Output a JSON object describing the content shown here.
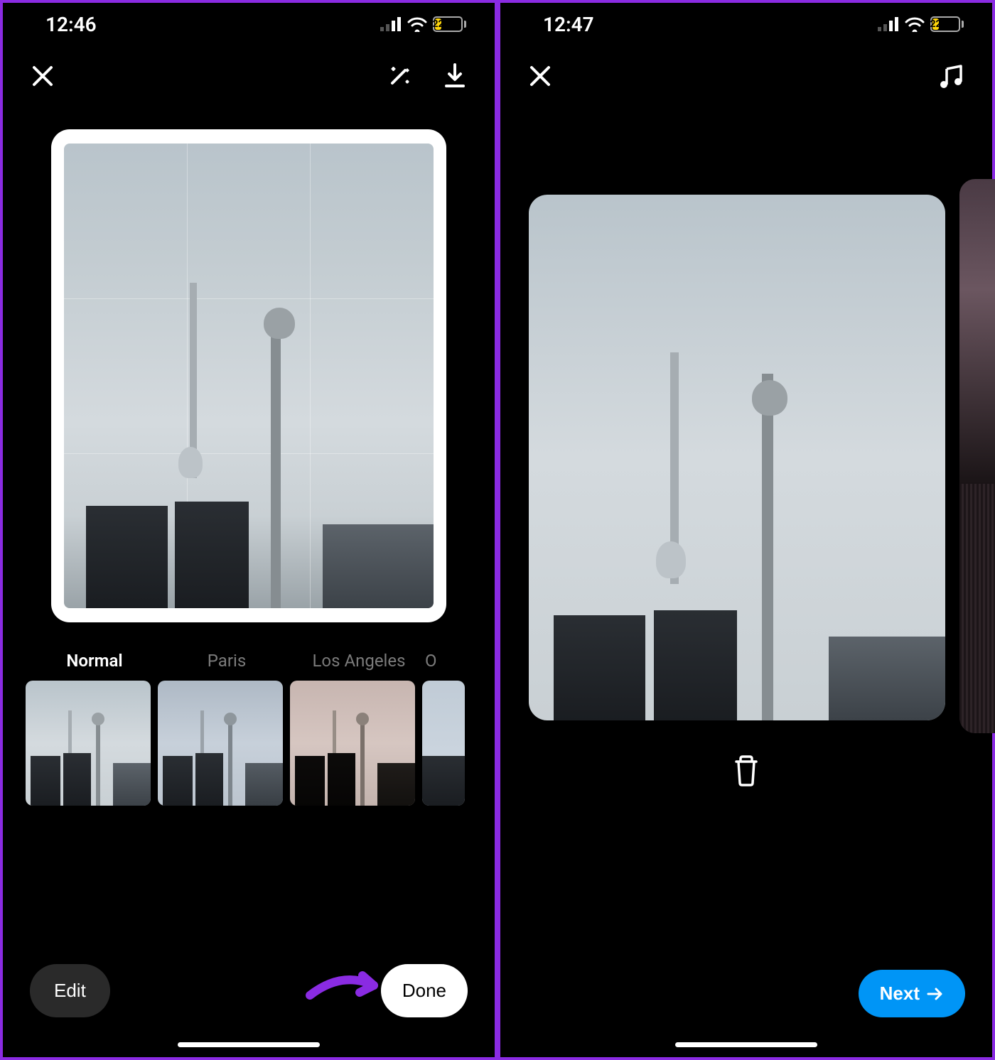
{
  "left": {
    "status": {
      "time": "12:46",
      "battery_pct": "22"
    },
    "filters": [
      {
        "name": "Normal",
        "active": true
      },
      {
        "name": "Paris",
        "active": false
      },
      {
        "name": "Los Angeles",
        "active": false
      },
      {
        "name_peek": "O"
      }
    ],
    "edit_label": "Edit",
    "done_label": "Done"
  },
  "right": {
    "status": {
      "time": "12:47",
      "battery_pct": "22"
    },
    "next_label": "Next"
  },
  "colors": {
    "accent_blue": "#0095f6",
    "annotation_purple": "#8a2be2",
    "battery_yellow": "#ffd60a"
  }
}
